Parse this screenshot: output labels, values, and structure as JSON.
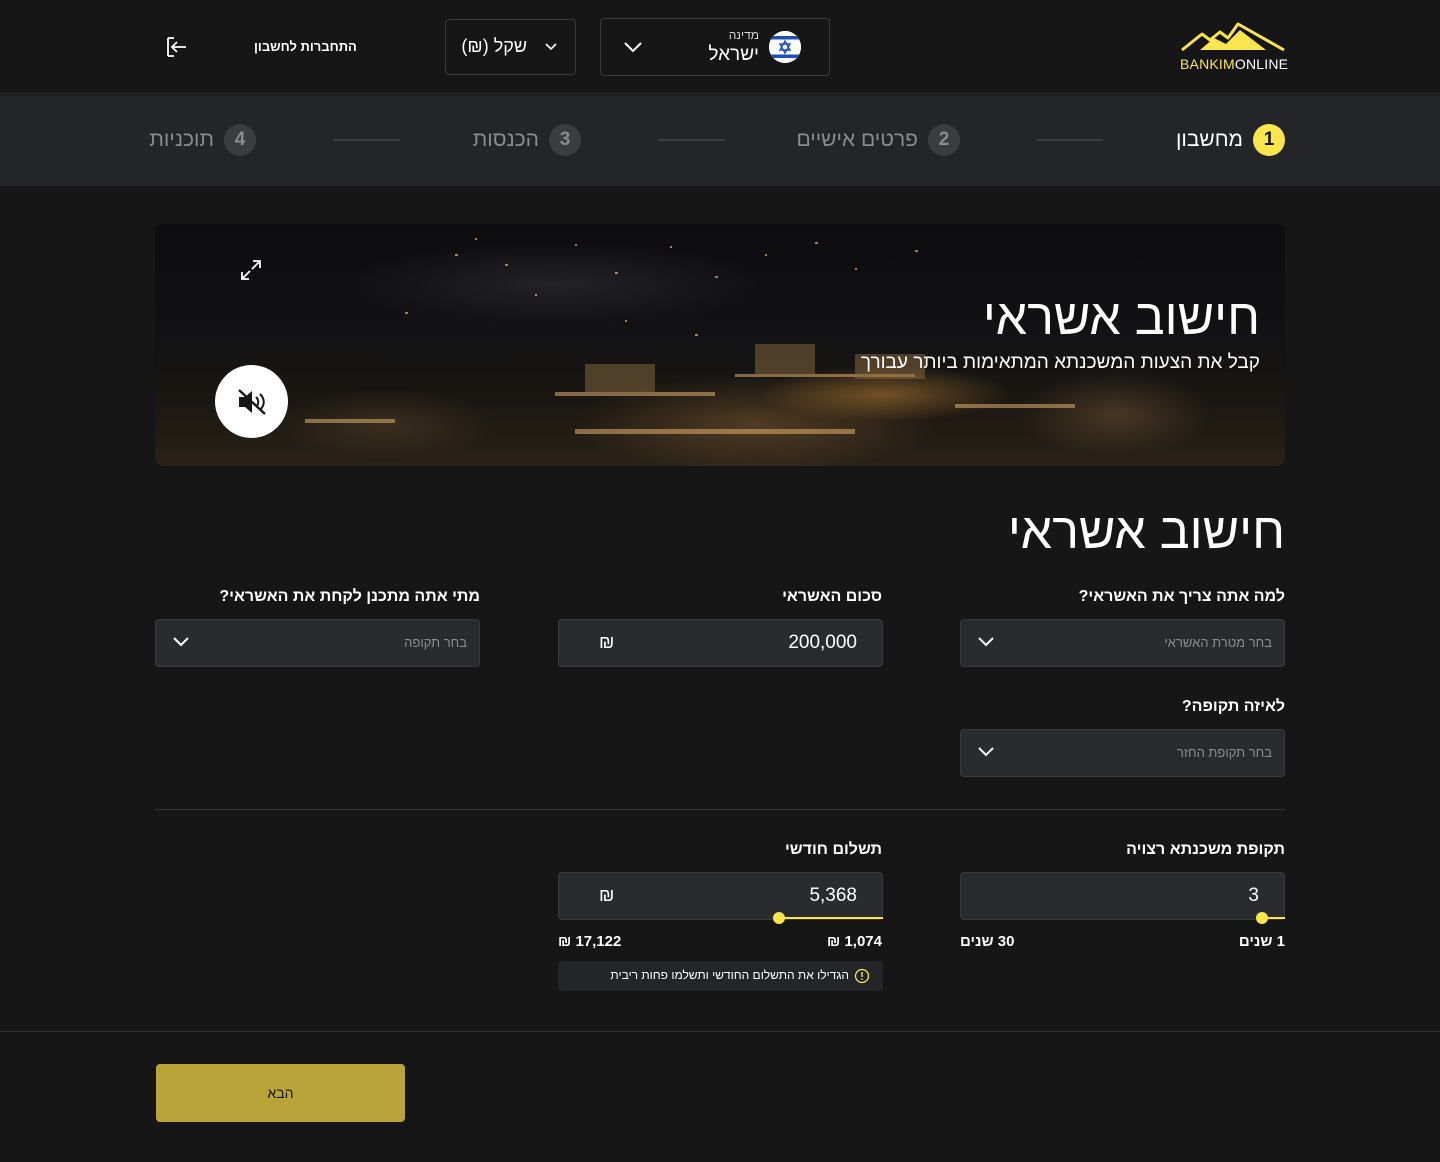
{
  "header": {
    "logo": {
      "brand_bold": "BANKIM",
      "brand_light": "ONLINE"
    },
    "country": {
      "label": "מדינה",
      "value": "ישראל",
      "flag_icon": "israel-flag-icon"
    },
    "currency": {
      "value": "(₪) שקל"
    },
    "login": {
      "label": "התחברות לחשבון",
      "icon": "login-icon"
    }
  },
  "stepper": {
    "steps": [
      {
        "num": "1",
        "label": "מחשבון",
        "active": true
      },
      {
        "num": "2",
        "label": "פרטים אישיים",
        "active": false
      },
      {
        "num": "3",
        "label": "הכנסות",
        "active": false
      },
      {
        "num": "4",
        "label": "תוכניות",
        "active": false
      }
    ]
  },
  "hero": {
    "title": "חישוב אשראי",
    "subtitle": "קבל את הצעות המשכנתא המתאימות ביותר עבורך",
    "expand_icon": "expand-icon",
    "mute_icon": "muted-speaker-icon"
  },
  "form": {
    "title": "חישוב אשראי",
    "purpose": {
      "label": "למה אתה צריך את האשראי?",
      "placeholder": "בחר מטרת האשראי"
    },
    "amount": {
      "label": "סכום האשראי",
      "value": "200,000",
      "currency": "₪"
    },
    "when": {
      "label": "מתי אתה מתכנן לקחת את האשראי?",
      "placeholder": "בחר תקופה"
    },
    "period": {
      "label": "לאיזה תקופה?",
      "placeholder": "בחר תקופת החזר"
    },
    "mortgage_term": {
      "label": "תקופת משכנתא רצויה",
      "value": "3",
      "min_label": "1 שנים",
      "max_label": "30 שנים",
      "fraction": 0.07
    },
    "monthly_payment": {
      "label": "תשלום חודשי",
      "value": "5,368",
      "currency": "₪",
      "min_label": "1,074 ₪",
      "max_label": "17,122 ₪",
      "fraction": 0.32,
      "hint": "הגדילו את התשלום החודשי ותשלמו פחות ריבית"
    }
  },
  "footer": {
    "next_label": "הבא"
  },
  "colors": {
    "accent": "#fbe54d",
    "button": "#b9a43a",
    "bg": "#161616",
    "stepper_bg": "#242529",
    "input_bg": "#2a2b2f"
  }
}
